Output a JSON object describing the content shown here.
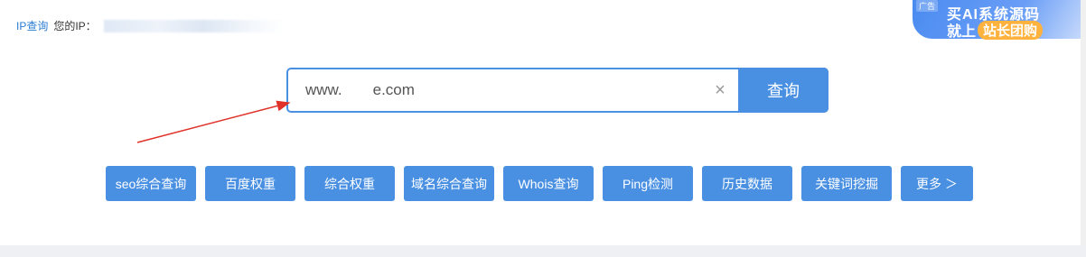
{
  "topbar": {
    "ip_link": "IP查询",
    "your_ip_label": "您的IP："
  },
  "ad": {
    "tag": "广告",
    "line1": "买AI系统源码",
    "line2_prefix": "就上",
    "line2_highlight": "站长团购"
  },
  "search": {
    "value": "www.",
    "value_suffix": "e.com",
    "clear_label": "×",
    "button_label": "查询"
  },
  "quick_buttons": [
    "seo综合查询",
    "百度权重",
    "综合权重",
    "域名综合查询",
    "Whois查询",
    "Ping检测",
    "历史数据",
    "关键词挖掘",
    "更多 ＞"
  ],
  "colors": {
    "accent": "#4a90e2",
    "arrow": "#e0322a",
    "link": "#2b7cd3"
  }
}
